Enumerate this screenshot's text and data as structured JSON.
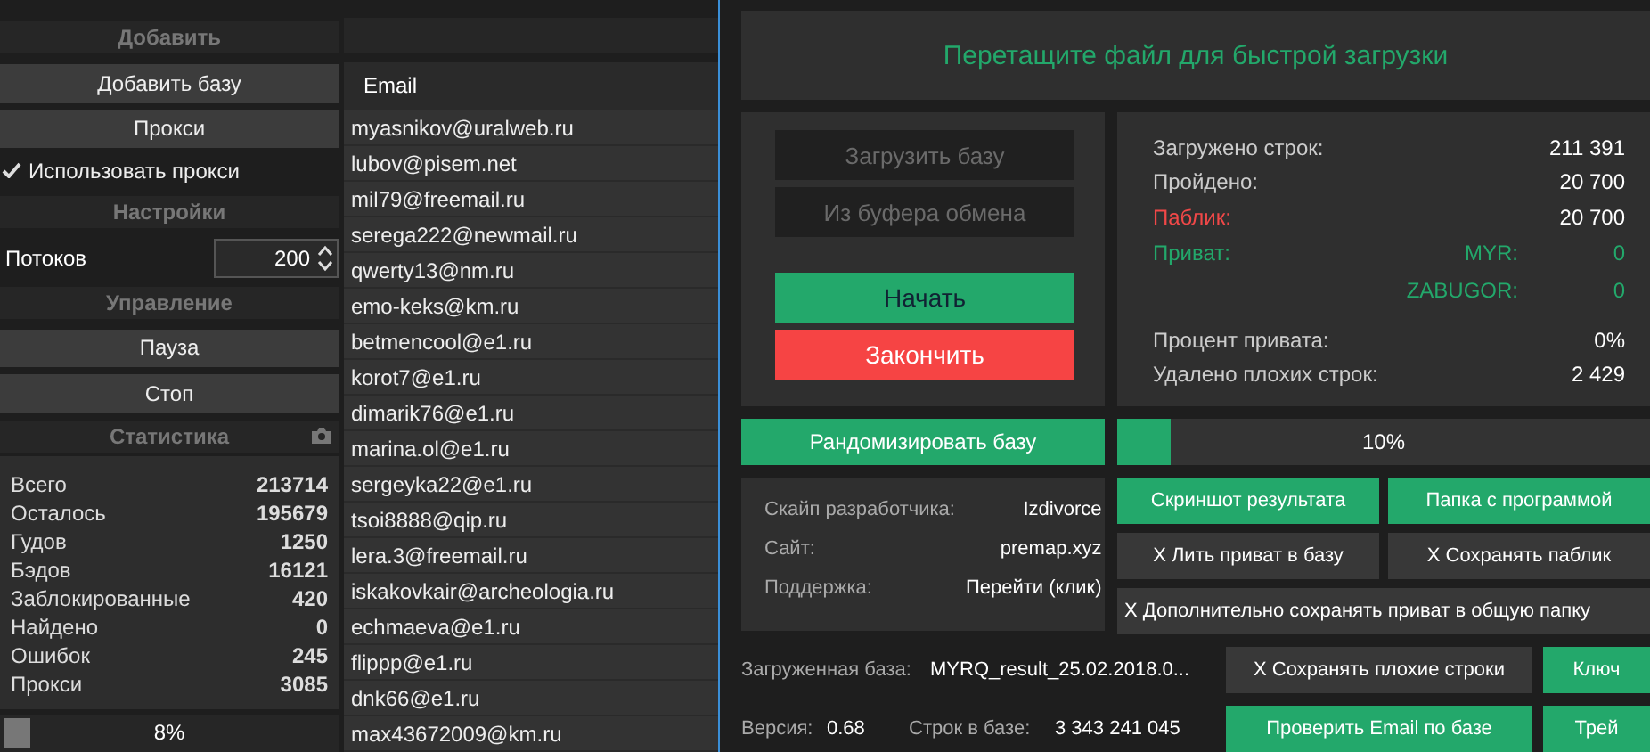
{
  "sidebar": {
    "sections": [
      {
        "title": "Добавить",
        "items": [
          {
            "kind": "button",
            "label": "Добавить базу"
          },
          {
            "kind": "button",
            "label": "Прокси"
          },
          {
            "kind": "checkbox",
            "label": "Использовать прокси",
            "checked": true
          }
        ]
      },
      {
        "title": "Настройки",
        "items": [
          {
            "kind": "spinner",
            "label": "Потоков",
            "value": "200"
          }
        ]
      },
      {
        "title": "Управление",
        "items": [
          {
            "kind": "button",
            "label": "Пауза"
          },
          {
            "kind": "button",
            "label": "Стоп"
          }
        ]
      }
    ],
    "stats": {
      "title": "Статистика",
      "rows": [
        {
          "label": "Всего",
          "value": "213714"
        },
        {
          "label": "Осталось",
          "value": "195679"
        },
        {
          "label": "Гудов",
          "value": "1250"
        },
        {
          "label": "Бэдов",
          "value": "16121"
        },
        {
          "label": "Заблокированные",
          "value": "420"
        },
        {
          "label": "Найдено",
          "value": "0"
        },
        {
          "label": "Ошибок",
          "value": "245"
        },
        {
          "label": "Прокси",
          "value": "3085"
        }
      ],
      "progress": {
        "level": 0.08,
        "text": "8%"
      }
    }
  },
  "email_table": {
    "column": "Email",
    "rows": [
      "myasnikov@uralweb.ru",
      "lubov@pisem.net",
      "mil79@freemail.ru",
      "serega222@newmail.ru",
      "qwerty13@nm.ru",
      "emo-keks@km.ru",
      "betmencool@e1.ru",
      "korot7@e1.ru",
      "dimarik76@e1.ru",
      "marina.ol@e1.ru",
      "sergeyka22@e1.ru",
      "tsoi8888@qip.ru",
      "lera.3@freemail.ru",
      "iskakovkair@archeologia.ru",
      "echmaeva@e1.ru",
      "flippp@e1.ru",
      "dnk66@e1.ru",
      "max43672009@km.ru"
    ]
  },
  "window": {
    "drop_zone": "Перетащите файл для быстрой загрузки",
    "load_buttons": [
      {
        "label": "Загрузить базу",
        "disabled": true
      },
      {
        "label": "Из буфера обмена",
        "disabled": true
      }
    ],
    "start_button": "Начать",
    "stop_button": "Закончить",
    "stats": [
      {
        "kind": "plain",
        "label": "Загружено строк:",
        "value": "211 391"
      },
      {
        "kind": "plain",
        "label": "Пройдено:",
        "value": "20 700"
      },
      {
        "kind": "public",
        "label": "Паблик:",
        "value": "20 700"
      },
      {
        "kind": "private",
        "label": "Приват:",
        "sublabel": "MYR:",
        "value": "0"
      },
      {
        "kind": "sub",
        "sublabel": "ZABUGOR:",
        "value": "0"
      },
      {
        "kind": "gap"
      },
      {
        "kind": "plain",
        "label": "Процент привата:",
        "value": "0%"
      },
      {
        "kind": "plain",
        "label": "Удалено плохих строк:",
        "value": "2 429"
      }
    ],
    "randomize_button": "Рандомизировать базу",
    "progress": {
      "level": 0.1,
      "text": "10%"
    },
    "info": [
      {
        "label": "Скайп разработчика:",
        "value": "Izdivorce"
      },
      {
        "label": "Сайт:",
        "value": "premap.xyz"
      },
      {
        "label": "Поддержка:",
        "value": "Перейти (клик)"
      }
    ],
    "action_buttons": [
      {
        "label": "Скриншот результата",
        "kind": "action"
      },
      {
        "label": "Папка с программой",
        "kind": "action"
      },
      {
        "label": "X Лить приват в базу",
        "kind": "toggle"
      },
      {
        "label": "X Сохранять паблик",
        "kind": "toggle"
      },
      {
        "label": "X Дополнительно сохранять приват в общую папку",
        "kind": "toggle"
      }
    ],
    "loaded_base": {
      "label": "Загруженная база:",
      "value": "MYRQ_result_25.02.2018.0..."
    },
    "version": {
      "label": "Версия:",
      "value": "0.68"
    },
    "rows_in_base": {
      "label": "Строк в базе:",
      "value": "3 343 241 045"
    },
    "bottom_buttons": [
      {
        "label": "X Сохранять плохие строки",
        "kind": "toggle"
      },
      {
        "label": "Ключ",
        "kind": "action"
      },
      {
        "label": "Проверить Email по базе",
        "kind": "action"
      },
      {
        "label": "Трей",
        "kind": "action"
      }
    ]
  }
}
